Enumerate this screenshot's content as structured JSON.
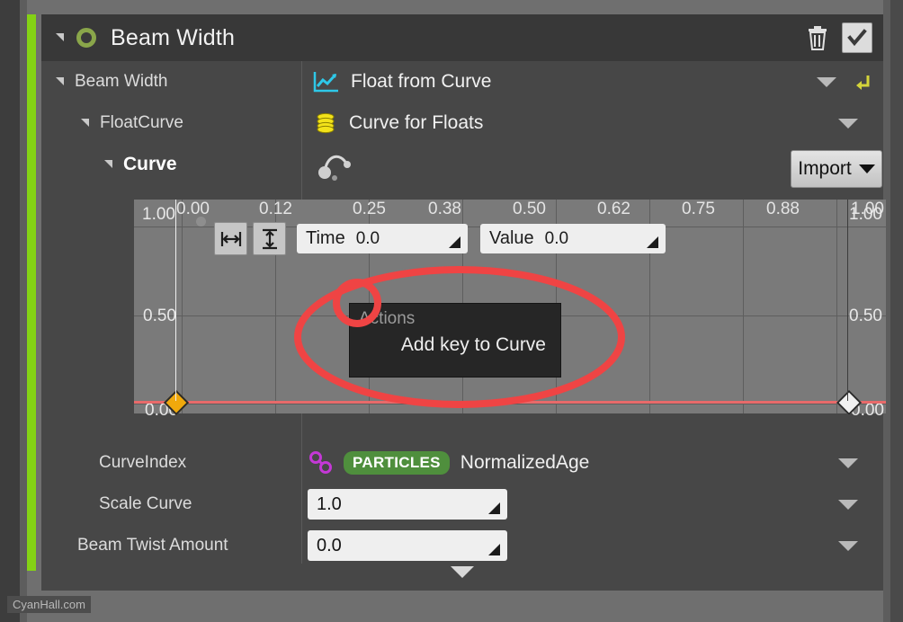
{
  "module": {
    "title": "Beam Width",
    "icon": "emitter-module-icon",
    "delete_icon": "trash-icon",
    "enabled_checkbox": "checkmark-icon"
  },
  "rows": [
    {
      "label": "Beam Width",
      "value": "Float from Curve",
      "icon": "curve-graph-icon",
      "has_dropdown": true,
      "has_reset": true
    },
    {
      "label": "FloatCurve",
      "value": "Curve for Floats",
      "icon": "database-stack-icon",
      "has_dropdown": true,
      "has_reset": false
    },
    {
      "label": "Curve",
      "value": "",
      "icon": "curve-node-icon",
      "has_dropdown": false,
      "has_reset": false
    }
  ],
  "graph": {
    "x_ticks": [
      "0.00",
      "0.12",
      "0.25",
      "0.38",
      "0.50",
      "0.62",
      "0.75",
      "0.88",
      "1.00"
    ],
    "y_ticks_left": [
      "1.00",
      "0.50",
      "0.00"
    ],
    "y_ticks_right": [
      "1.00",
      "0.50",
      "0.00"
    ],
    "toolbar": {
      "fit_horizontal_icon": "fit-horizontal-icon",
      "fit_vertical_icon": "fit-vertical-icon",
      "time_label": "Time",
      "time_value": "0.0",
      "value_label": "Value",
      "value_value": "0.0"
    },
    "keys": [
      {
        "name": "curve-key-start",
        "time": "0.00",
        "value": "0.00",
        "selected": true
      },
      {
        "name": "curve-key-end",
        "time": "1.00",
        "value": "0.00",
        "selected": false
      }
    ],
    "import_button": "Import"
  },
  "context_menu": {
    "header": "Actions",
    "items": [
      "Add key to Curve"
    ]
  },
  "properties": [
    {
      "label": "CurveIndex",
      "type": "distribution",
      "badge": "PARTICLES",
      "value": "NormalizedAge",
      "has_dropdown": true
    },
    {
      "label": "Scale Curve",
      "type": "number",
      "value": "1.0",
      "has_dropdown": true
    },
    {
      "label": "Beam Twist Amount",
      "type": "number",
      "value": "0.0",
      "has_dropdown": true
    }
  ],
  "footer": {
    "collapse_icon": "chevron-down-icon"
  },
  "watermark": "CyanHall.com",
  "colors": {
    "accent_green": "#7ed321",
    "panel_bg": "#474747",
    "header_bg": "#383838",
    "graph_bg": "#7a7a7a",
    "curve_red": "#e86a6a",
    "annotation_red": "#ef4444",
    "badge_green": "#4f8f3d",
    "key_selected": "#f0a90c",
    "reset_yellow": "#d4d43a"
  }
}
